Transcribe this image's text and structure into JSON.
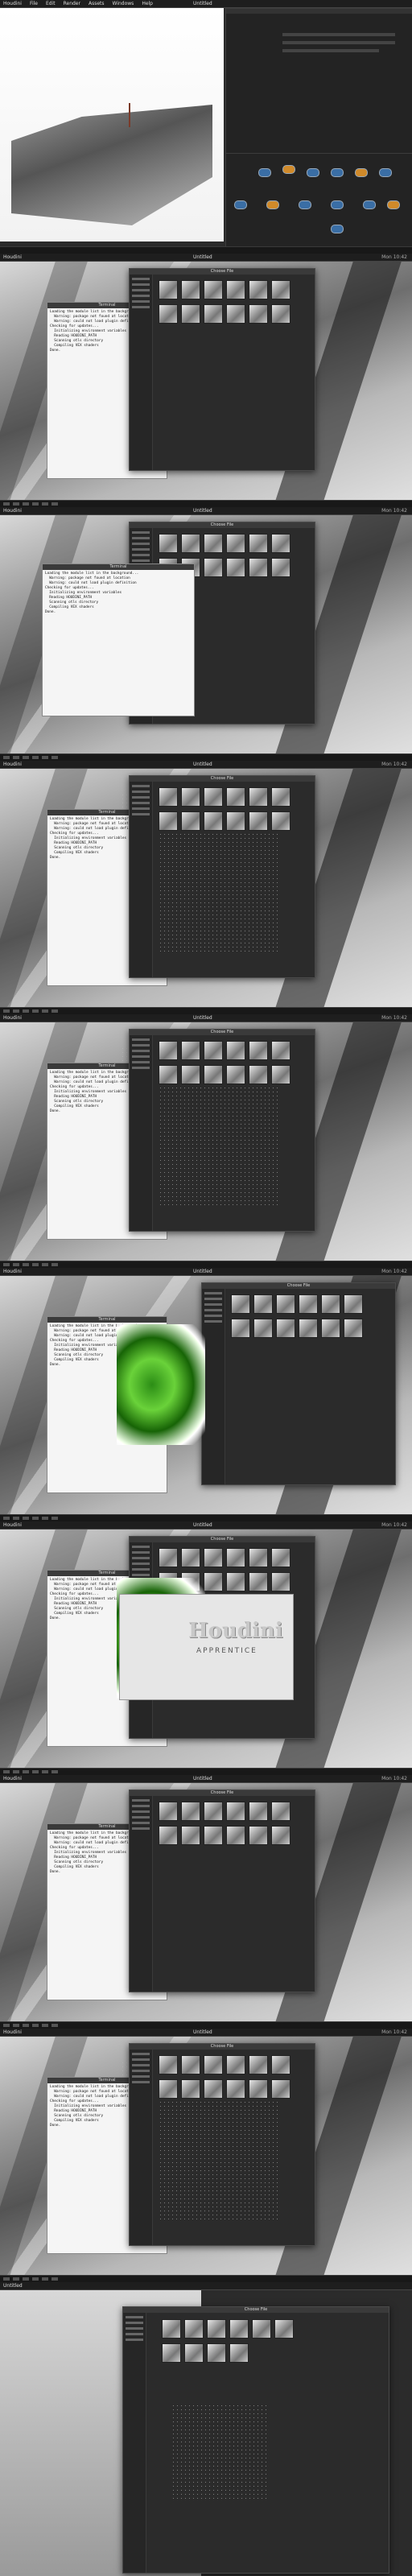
{
  "app": {
    "menu": [
      "Houdini",
      "File",
      "Edit",
      "Render",
      "Assets",
      "Windows",
      "Help"
    ],
    "window_title": "Untitled",
    "status_right": "Mon 10:42"
  },
  "frames": [
    {
      "label": "Houdini viewport"
    },
    {
      "label": "File browser"
    },
    {
      "label": "File browser"
    },
    {
      "label": "File browser"
    },
    {
      "label": "File browser"
    },
    {
      "label": "File browser"
    },
    {
      "label": "Splash"
    },
    {
      "label": "File browser"
    },
    {
      "label": "File browser"
    }
  ],
  "console": {
    "title": "Terminal",
    "lines": [
      "Loading the module list in the background...",
      "  Warning: package not found at location",
      "  Warning: could not load plugin definition",
      "Checking for updates...",
      "  Initializing environment variables",
      "  Reading HOUDINI_PATH",
      "  Scanning otls directory",
      "  Compiling VEX shaders",
      "Done."
    ]
  },
  "splash": {
    "logo": "Houdini",
    "subtitle": "APPRENTICE"
  },
  "file_window": {
    "title": "Choose File"
  }
}
